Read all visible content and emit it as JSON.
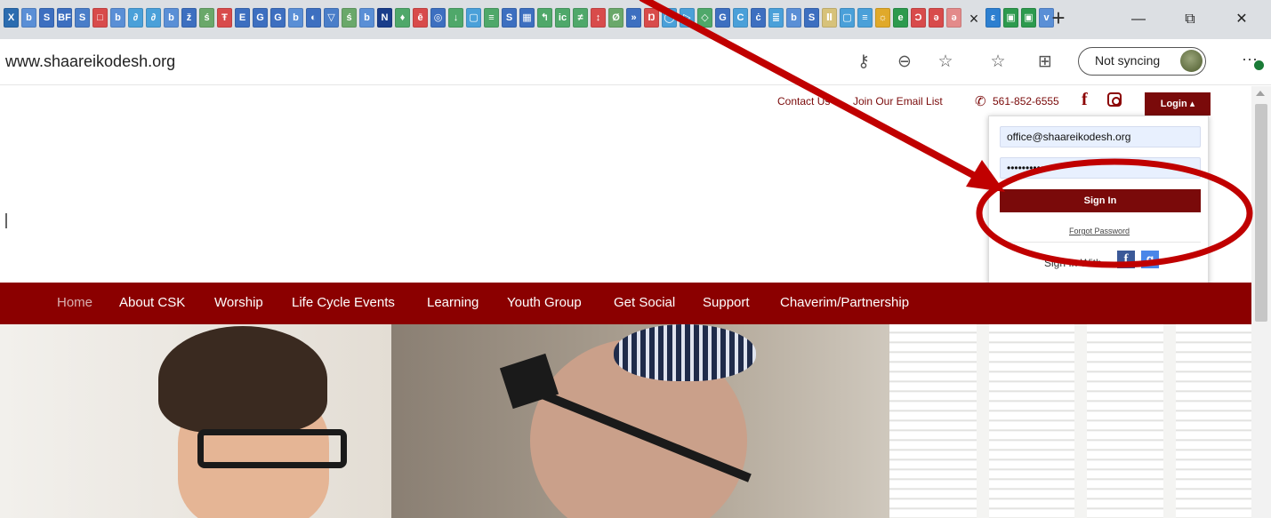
{
  "browser": {
    "tab_favicons": [
      {
        "glyph": "X",
        "color": "#2b6cb0"
      },
      {
        "glyph": "b",
        "color": "#5a8fd6"
      },
      {
        "glyph": "S",
        "color": "#3d6fc0"
      },
      {
        "glyph": "BF",
        "color": "#3d6fc0"
      },
      {
        "glyph": "S",
        "color": "#4a7ec9"
      },
      {
        "glyph": "□",
        "color": "#d84b4b"
      },
      {
        "glyph": "b",
        "color": "#5a8fd6"
      },
      {
        "glyph": "∂",
        "color": "#4aa0d9"
      },
      {
        "glyph": "∂",
        "color": "#4aa0d9"
      },
      {
        "glyph": "b",
        "color": "#5a8fd6"
      },
      {
        "glyph": "ž",
        "color": "#3d6fc0"
      },
      {
        "glyph": "ś",
        "color": "#6aa86a"
      },
      {
        "glyph": "Ŧ",
        "color": "#d84b4b"
      },
      {
        "glyph": "E",
        "color": "#3d6fc0"
      },
      {
        "glyph": "G",
        "color": "#3d6fc0"
      },
      {
        "glyph": "G",
        "color": "#3d6fc0"
      },
      {
        "glyph": "b",
        "color": "#5a8fd6"
      },
      {
        "glyph": "◐",
        "color": "#3d6fc0"
      },
      {
        "glyph": "▽",
        "color": "#4a7ec9"
      },
      {
        "glyph": "ś",
        "color": "#6aa86a"
      },
      {
        "glyph": "b",
        "color": "#5a8fd6"
      },
      {
        "glyph": "N",
        "color": "#1a3d8a"
      },
      {
        "glyph": "♦",
        "color": "#4fa86a"
      },
      {
        "glyph": "ē",
        "color": "#d84b4b"
      },
      {
        "glyph": "◎",
        "color": "#3d6fc0"
      },
      {
        "glyph": "↓",
        "color": "#4fa86a"
      },
      {
        "glyph": "▢",
        "color": "#4aa0d9"
      },
      {
        "glyph": "≡",
        "color": "#4fa86a"
      },
      {
        "glyph": "S",
        "color": "#3d6fc0"
      },
      {
        "glyph": "▦",
        "color": "#3d6fc0"
      },
      {
        "glyph": "↰",
        "color": "#4fa86a"
      },
      {
        "glyph": "ic",
        "color": "#4fa86a"
      },
      {
        "glyph": "≠",
        "color": "#4fa86a"
      },
      {
        "glyph": "↕",
        "color": "#d84b4b"
      },
      {
        "glyph": "Ø",
        "color": "#6aa86a"
      },
      {
        "glyph": "»",
        "color": "#3d6fc0"
      },
      {
        "glyph": "Ŋ",
        "color": "#d84b4b"
      },
      {
        "glyph": "◯",
        "color": "#4aa0d9"
      },
      {
        "glyph": "▷",
        "color": "#4aa0d9"
      },
      {
        "glyph": "◇",
        "color": "#4fa86a"
      },
      {
        "glyph": "G",
        "color": "#3d6fc0"
      },
      {
        "glyph": "C",
        "color": "#4aa0d9"
      },
      {
        "glyph": "ċ",
        "color": "#3d6fc0"
      },
      {
        "glyph": "≣",
        "color": "#4aa0d9"
      },
      {
        "glyph": "b",
        "color": "#5a8fd6"
      },
      {
        "glyph": "S",
        "color": "#3d6fc0"
      },
      {
        "glyph": "Ⅱ",
        "color": "#d7c27a"
      },
      {
        "glyph": "▢",
        "color": "#4aa0d9"
      },
      {
        "glyph": "≡",
        "color": "#4aa0d9"
      },
      {
        "glyph": "☼",
        "color": "#e0a92a"
      },
      {
        "glyph": "e",
        "color": "#2d9a4e"
      },
      {
        "glyph": "Ɔ",
        "color": "#d84b4b"
      },
      {
        "glyph": "ə",
        "color": "#d84b4b"
      },
      {
        "glyph": "ə",
        "color": "#e38a8a"
      }
    ],
    "active_tab_close": "×",
    "trailing_tab_favicons": [
      {
        "glyph": "ε",
        "color": "#2d7fd0"
      },
      {
        "glyph": "▣",
        "color": "#2d9a4e"
      },
      {
        "glyph": "▣",
        "color": "#2d9a4e"
      },
      {
        "glyph": "v",
        "color": "#5a8fd6"
      }
    ],
    "new_tab": "+",
    "minimize": "—",
    "restore": "⧉",
    "close": "✕",
    "url": "www.shaareikodesh.org",
    "sync_label": "Not syncing",
    "more": "···"
  },
  "topbar": {
    "contact": "Contact Us",
    "email_list": "Join Our Email List",
    "phone": "561-852-6555",
    "facebook_glyph": "f",
    "login_label": "Login ▴"
  },
  "login_panel": {
    "email_value": "office@shaareikodesh.org",
    "password_value": "••••••••••",
    "signin_label": "Sign In",
    "forgot_label": "Forgot Password",
    "signin_with": "Sign In With",
    "fb_glyph": "f",
    "google_glyph": "g"
  },
  "nav": {
    "items": [
      "Home",
      "About CSK",
      "Worship",
      "Life Cycle Events",
      "Learning",
      "Youth Group",
      "Get Social",
      "Support",
      "Chaverim/Partnership"
    ]
  },
  "colors": {
    "brand": "#8b0000",
    "annotation": "#c00000"
  }
}
